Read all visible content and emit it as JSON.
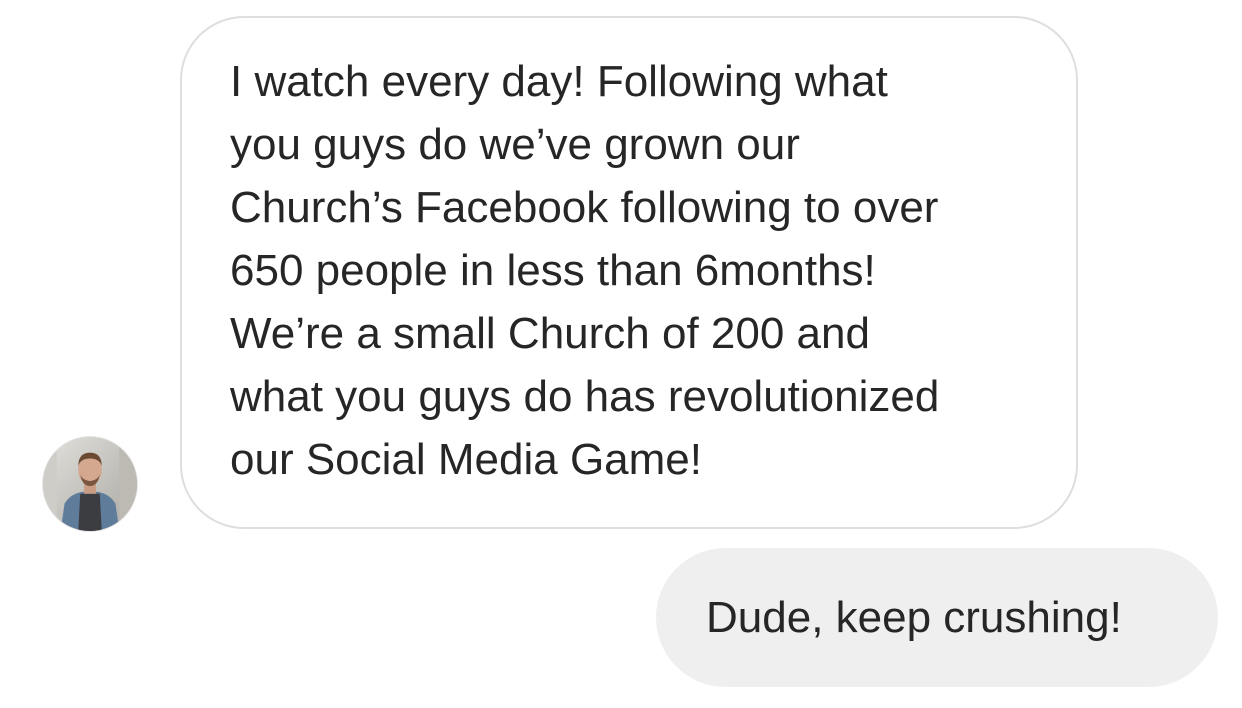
{
  "conversation": {
    "received_message": {
      "lines": [
        "I watch every day! Following what",
        "you guys do we’ve grown our",
        "Church’s Facebook following to over",
        "650 people in less than 6months!",
        "We’re a small Church of 200 and",
        "what you guys do has revolutionized",
        "our Social Media Game!"
      ],
      "avatar_icon": "user-avatar-photo"
    },
    "sent_message": {
      "text": "Dude, keep crushing!"
    }
  },
  "colors": {
    "background": "#ffffff",
    "text": "#262626",
    "received_bubble_border": "#dedede",
    "sent_bubble_fill": "#efefef"
  }
}
